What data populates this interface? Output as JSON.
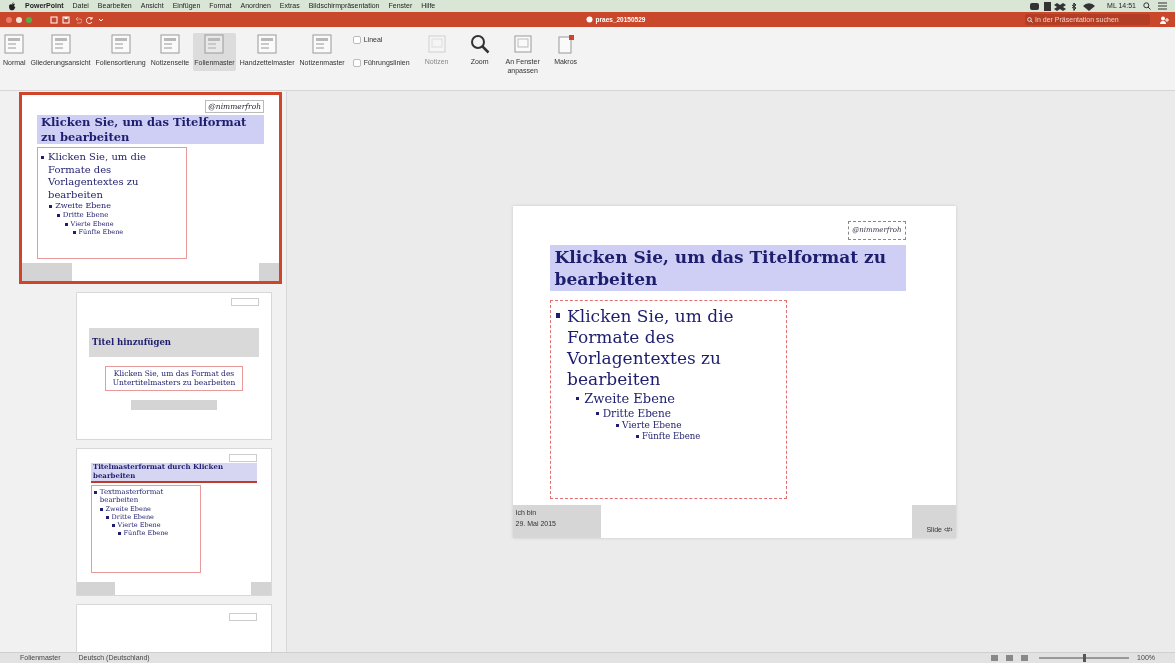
{
  "menubar": {
    "items": [
      "PowerPoint",
      "Datei",
      "Bearbeiten",
      "Ansicht",
      "Einfügen",
      "Format",
      "Anordnen",
      "Extras",
      "Bildschirmpräsentation",
      "Fenster",
      "Hilfe"
    ],
    "clock": "ML 14:51"
  },
  "window": {
    "title": "praes_20150529",
    "search": {
      "placeholder": "In der Präsentation suchen"
    }
  },
  "ribbon": [
    {
      "kind": "view",
      "label": "Normal",
      "selected": false
    },
    {
      "kind": "view",
      "label": "Gliederungsansicht",
      "selected": false
    },
    {
      "kind": "view",
      "label": "Foliensortierung",
      "selected": false
    },
    {
      "kind": "view",
      "label": "Notizenseite",
      "selected": false
    },
    {
      "kind": "view",
      "label": "Folienmaster",
      "selected": true
    },
    {
      "kind": "view",
      "label": "Handzettelmaster",
      "selected": false
    },
    {
      "kind": "view",
      "label": "Notizenmaster",
      "selected": false
    },
    {
      "kind": "checks",
      "items": [
        {
          "label": "Lineal",
          "checked": false
        },
        {
          "label": "Führungslinien",
          "checked": false
        }
      ]
    },
    {
      "kind": "tool",
      "label": "Notizen",
      "disabled": true
    },
    {
      "kind": "zoom",
      "label": "Zoom",
      "disabled": false
    },
    {
      "kind": "tool",
      "label": "An Fenster anpassen",
      "disabled": false
    },
    {
      "kind": "macro",
      "label": "Makros",
      "disabled": false
    }
  ],
  "thumbnails": [
    {
      "kind": "master",
      "selected": true,
      "tag": "@nimmerfroh",
      "title": "Klicken Sie, um das Titelformat zu bearbeiten",
      "body": [
        {
          "text": "Klicken Sie, um die Formate des Vorlagentextes zu bearbeiten",
          "children": [
            {
              "text": "Zweite Ebene",
              "children": [
                {
                  "text": "Dritte Ebene",
                  "children": [
                    {
                      "text": "Vierte Ebene",
                      "children": [
                        {
                          "text": "Fünfte Ebene"
                        }
                      ]
                    }
                  ]
                }
              ]
            }
          ]
        }
      ]
    },
    {
      "kind": "title",
      "selected": false,
      "title": "Titel hinzufügen",
      "subtitle": "Klicken Sie, um das Format des Untertitelmasters zu bearbeiten"
    },
    {
      "kind": "content",
      "selected": false,
      "title": "Titelmasterformat durch Klicken bearbeiten",
      "body": [
        {
          "text": "Textmasterformat bearbeiten",
          "children": [
            {
              "text": "Zweite Ebene",
              "children": [
                {
                  "text": "Dritte Ebene",
                  "children": [
                    {
                      "text": "Vierte Ebene",
                      "children": [
                        {
                          "text": "Fünfte Ebene"
                        }
                      ]
                    }
                  ]
                }
              ]
            }
          ]
        }
      ]
    },
    {
      "kind": "blank",
      "selected": false
    }
  ],
  "slide": {
    "tag": "@nimmerfroh",
    "title": "Klicken Sie, um das Titelformat zu bearbeiten",
    "body": [
      {
        "text": "Klicken Sie, um die Formate des Vorlagentextes zu bearbeiten",
        "children": [
          {
            "text": "Zweite Ebene",
            "children": [
              {
                "text": "Dritte Ebene",
                "children": [
                  {
                    "text": "Vierte Ebene",
                    "children": [
                      {
                        "text": "Fünfte Ebene"
                      }
                    ]
                  }
                ]
              }
            ]
          }
        ]
      }
    ],
    "footer_left": [
      "Ich bin",
      "29. Mai 2015"
    ],
    "footer_right": "Slide ‹#›"
  },
  "status_bar": {
    "view": "Folienmaster",
    "language": "Deutsch (Deutschland)",
    "zoom": "100%",
    "zoom_slider": {
      "level": 0.5
    }
  }
}
